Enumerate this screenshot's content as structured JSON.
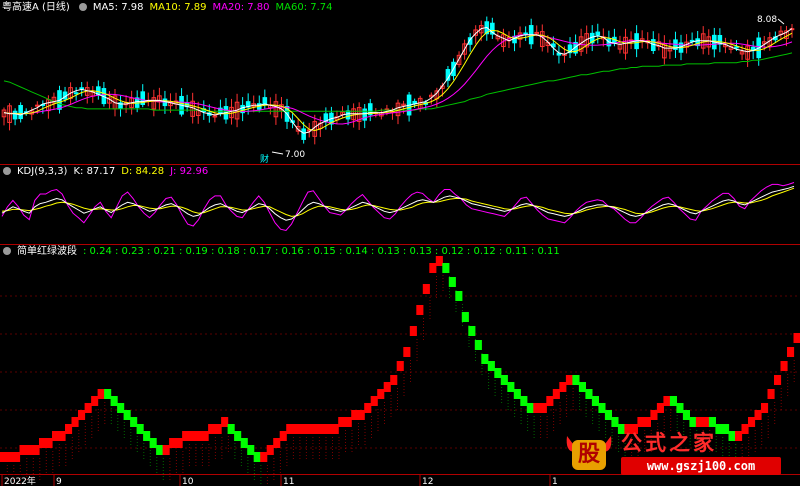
{
  "price_header": {
    "name": "粤高速A (日线)",
    "ma5": "MA5: 7.98",
    "ma10": "MA10: 7.89",
    "ma20": "MA20: 7.80",
    "ma60": "MA60: 7.74",
    "high_label": "8.08",
    "low_label": "7.00",
    "cai_mark": "财"
  },
  "kdj_header": {
    "name": "KDJ(9,3,3)",
    "k": "K: 87.17",
    "d": "D: 84.28",
    "j": "J: 92.96"
  },
  "wave_header": {
    "name": "简单红绿波段",
    "values": ": 0.24 : 0.23 : 0.21 : 0.19 : 0.18 : 0.17 : 0.16 : 0.15 : 0.14 : 0.13 : 0.13 : 0.12 : 0.12 : 0.11 : 0.11"
  },
  "x_axis": {
    "labels": [
      "2022年",
      "9",
      "10",
      "11",
      "12",
      "1"
    ]
  },
  "watermark": {
    "logo_text": "股",
    "title": "公式之家",
    "url": "www.gszj100.com"
  },
  "colors": {
    "up": "#ff3232",
    "down": "#00ffff",
    "ma5": "#ffffff",
    "ma10": "#ffff00",
    "ma20": "#ff00ff",
    "ma60": "#00c000",
    "k": "#ffffff",
    "d": "#ffff00",
    "j": "#ff00ff",
    "wave_up": "#ff0000",
    "wave_down": "#00ff00",
    "axis": "#b00000"
  },
  "chart_data": [
    {
      "type": "candlestick",
      "title": "粤高速A (日线)",
      "series": [
        {
          "name": "MA5",
          "values": [
            7.34,
            7.33,
            7.33,
            7.32,
            7.34,
            7.36,
            7.38,
            7.41,
            7.42,
            7.43,
            7.44,
            7.47,
            7.5,
            7.52,
            7.53,
            7.52,
            7.51,
            7.49,
            7.47,
            7.45,
            7.42,
            7.41,
            7.41,
            7.42,
            7.43,
            7.43,
            7.44,
            7.44,
            7.44,
            7.43,
            7.42,
            7.41,
            7.4,
            7.39,
            7.38,
            7.36,
            7.34,
            7.33,
            7.32,
            7.33,
            7.34,
            7.35,
            7.36,
            7.38,
            7.39,
            7.4,
            7.4,
            7.41,
            7.4,
            7.39,
            7.37,
            7.33,
            7.26,
            7.2,
            7.17,
            7.18,
            7.22,
            7.25,
            7.27,
            7.29,
            7.3,
            7.32,
            7.33,
            7.33,
            7.33,
            7.33,
            7.34,
            7.34,
            7.34,
            7.35,
            7.36,
            7.38,
            7.39,
            7.4,
            7.41,
            7.42,
            7.43,
            7.46,
            7.5,
            7.56,
            7.62,
            7.7,
            7.78,
            7.86,
            7.94,
            7.99,
            8.03,
            8.04,
            8.0,
            7.97,
            7.95,
            7.93,
            7.95,
            7.97,
            7.98,
            7.98,
            7.98,
            7.96,
            7.92,
            7.87,
            7.83,
            7.82,
            7.84,
            7.88,
            7.91,
            7.94,
            7.96,
            7.97,
            7.96,
            7.92,
            7.91,
            7.9,
            7.91,
            7.92,
            7.93,
            7.93,
            7.92,
            7.9,
            7.89,
            7.87,
            7.87,
            7.87,
            7.88,
            7.9,
            7.92,
            7.93,
            7.93,
            7.93,
            7.92,
            7.91,
            7.9,
            7.88,
            7.86,
            7.85,
            7.84,
            7.85,
            7.87,
            7.9,
            7.93,
            7.96,
            7.98,
            8.0,
            8.03
          ]
        },
        {
          "name": "MA60",
          "values": [
            7.6,
            7.59,
            7.57,
            7.55,
            7.53,
            7.51,
            7.49,
            7.47,
            7.45,
            7.43,
            7.41,
            7.4,
            7.39,
            7.38,
            7.38,
            7.37,
            7.37,
            7.37,
            7.37,
            7.37,
            7.37,
            7.37,
            7.37,
            7.37,
            7.37,
            7.37,
            7.37,
            7.36,
            7.36,
            7.36,
            7.36,
            7.36,
            7.36,
            7.36,
            7.36,
            7.36,
            7.36,
            7.35,
            7.35,
            7.35,
            7.35,
            7.35,
            7.35,
            7.35,
            7.35,
            7.35,
            7.35,
            7.35,
            7.35,
            7.35,
            7.35,
            7.35,
            7.35,
            7.35,
            7.35,
            7.35,
            7.35,
            7.35,
            7.35,
            7.35,
            7.35,
            7.35,
            7.35,
            7.35,
            7.35,
            7.35,
            7.35,
            7.35,
            7.36,
            7.36,
            7.36,
            7.36,
            7.36,
            7.36,
            7.36,
            7.37,
            7.37,
            7.37,
            7.38,
            7.39,
            7.4,
            7.41,
            7.42,
            7.43,
            7.45,
            7.46,
            7.47,
            7.49,
            7.5,
            7.51,
            7.52,
            7.53,
            7.54,
            7.55,
            7.56,
            7.57,
            7.58,
            7.59,
            7.6,
            7.6,
            7.61,
            7.62,
            7.63,
            7.64,
            7.65,
            7.65,
            7.66,
            7.67,
            7.68,
            7.68,
            7.69,
            7.7,
            7.7,
            7.71,
            7.71,
            7.72,
            7.72,
            7.72,
            7.72,
            7.73,
            7.73,
            7.73,
            7.73,
            7.74,
            7.74,
            7.74,
            7.74,
            7.74,
            7.75,
            7.75,
            7.75,
            7.75,
            7.75,
            7.76,
            7.76,
            7.77,
            7.77,
            7.78,
            7.79,
            7.8,
            7.81,
            7.82,
            7.83
          ]
        }
      ],
      "price_range": [
        6.95,
        8.15
      ]
    },
    {
      "type": "line",
      "title": "KDJ(9,3,3)",
      "series": [
        {
          "name": "K",
          "values": [
            45,
            50,
            55,
            52,
            48,
            45,
            55,
            60,
            62,
            65,
            68,
            66,
            60,
            55,
            50,
            45,
            48,
            52,
            55,
            50,
            46,
            52,
            58,
            62,
            60,
            56,
            52,
            48,
            50,
            54,
            58,
            60,
            56,
            50,
            44,
            40,
            42,
            48,
            54,
            58,
            60,
            56,
            52,
            48,
            46,
            50,
            55,
            60,
            58,
            52,
            44,
            38,
            34,
            36,
            42,
            50,
            58,
            62,
            60,
            56,
            52,
            50,
            48,
            50,
            54,
            58,
            62,
            60,
            56,
            52,
            48,
            46,
            48,
            52,
            56,
            60,
            64,
            66,
            64,
            62,
            66,
            70,
            72,
            70,
            68,
            64,
            60,
            58,
            56,
            54,
            52,
            50,
            48,
            50,
            54,
            58,
            60,
            58,
            54,
            50,
            46,
            44,
            42,
            40,
            42,
            46,
            50,
            54,
            56,
            58,
            58,
            56,
            54,
            50,
            46,
            42,
            40,
            42,
            46,
            50,
            54,
            58,
            60,
            58,
            54,
            50,
            46,
            44,
            48,
            52,
            56,
            60,
            64,
            66,
            64,
            60,
            58,
            62,
            66,
            70,
            74,
            78,
            80,
            82,
            84,
            87
          ]
        },
        {
          "name": "D",
          "values": [
            48,
            49,
            51,
            51,
            50,
            49,
            51,
            53,
            56,
            58,
            61,
            62,
            61,
            59,
            56,
            53,
            51,
            51,
            52,
            51,
            50,
            50,
            52,
            55,
            57,
            57,
            55,
            53,
            52,
            52,
            54,
            56,
            56,
            54,
            51,
            47,
            45,
            46,
            49,
            52,
            55,
            55,
            54,
            52,
            50,
            50,
            52,
            54,
            56,
            55,
            51,
            47,
            43,
            40,
            41,
            44,
            49,
            53,
            56,
            56,
            55,
            53,
            51,
            50,
            51,
            53,
            56,
            58,
            57,
            55,
            53,
            51,
            50,
            50,
            52,
            54,
            58,
            61,
            62,
            62,
            63,
            65,
            67,
            68,
            68,
            67,
            64,
            62,
            60,
            58,
            56,
            54,
            52,
            51,
            52,
            54,
            56,
            57,
            56,
            54,
            51,
            49,
            47,
            45,
            44,
            45,
            47,
            50,
            52,
            54,
            55,
            56,
            55,
            53,
            51,
            48,
            45,
            44,
            45,
            47,
            50,
            53,
            55,
            56,
            55,
            53,
            51,
            49,
            48,
            50,
            52,
            55,
            58,
            61,
            62,
            62,
            61,
            61,
            63,
            65,
            68,
            72,
            75,
            78,
            81,
            84
          ]
        },
        {
          "name": "J",
          "values": [
            40,
            55,
            65,
            55,
            42,
            35,
            65,
            75,
            75,
            80,
            82,
            75,
            58,
            45,
            38,
            30,
            42,
            55,
            62,
            48,
            38,
            55,
            72,
            78,
            68,
            55,
            45,
            38,
            46,
            58,
            68,
            70,
            58,
            42,
            28,
            25,
            35,
            52,
            66,
            72,
            72,
            58,
            48,
            40,
            38,
            50,
            62,
            72,
            62,
            46,
            30,
            20,
            18,
            28,
            45,
            62,
            78,
            80,
            68,
            56,
            46,
            44,
            42,
            50,
            60,
            68,
            74,
            64,
            54,
            46,
            38,
            36,
            44,
            56,
            66,
            74,
            78,
            76,
            68,
            62,
            74,
            82,
            82,
            74,
            68,
            58,
            52,
            50,
            48,
            46,
            44,
            42,
            40,
            48,
            58,
            68,
            70,
            60,
            50,
            42,
            36,
            34,
            32,
            30,
            38,
            48,
            56,
            62,
            64,
            66,
            64,
            56,
            52,
            44,
            36,
            30,
            30,
            38,
            48,
            56,
            62,
            68,
            70,
            62,
            52,
            44,
            36,
            34,
            48,
            56,
            64,
            70,
            76,
            76,
            68,
            56,
            52,
            64,
            72,
            80,
            86,
            90,
            90,
            88,
            90,
            93
          ]
        }
      ],
      "ylim": [
        0,
        100
      ]
    },
    {
      "type": "step",
      "title": "简单红绿波段",
      "series": [
        {
          "name": "简单红绿波段",
          "values": [
            0.11,
            0.11,
            0.11,
            0.12,
            0.12,
            0.12,
            0.13,
            0.13,
            0.14,
            0.14,
            0.15,
            0.16,
            0.17,
            0.18,
            0.19,
            0.2,
            0.2,
            0.19,
            0.18,
            0.17,
            0.16,
            0.15,
            0.14,
            0.13,
            0.12,
            0.12,
            0.13,
            0.13,
            0.14,
            0.14,
            0.14,
            0.14,
            0.15,
            0.15,
            0.16,
            0.15,
            0.14,
            0.13,
            0.12,
            0.11,
            0.11,
            0.12,
            0.13,
            0.14,
            0.15,
            0.15,
            0.15,
            0.15,
            0.15,
            0.15,
            0.15,
            0.15,
            0.16,
            0.16,
            0.17,
            0.17,
            0.18,
            0.19,
            0.2,
            0.21,
            0.22,
            0.24,
            0.26,
            0.29,
            0.32,
            0.35,
            0.38,
            0.39,
            0.38,
            0.36,
            0.34,
            0.31,
            0.29,
            0.27,
            0.25,
            0.24,
            0.23,
            0.22,
            0.21,
            0.2,
            0.19,
            0.18,
            0.18,
            0.18,
            0.19,
            0.2,
            0.21,
            0.22,
            0.22,
            0.21,
            0.2,
            0.19,
            0.18,
            0.17,
            0.16,
            0.15,
            0.15,
            0.15,
            0.16,
            0.16,
            0.17,
            0.18,
            0.19,
            0.19,
            0.18,
            0.17,
            0.16,
            0.16,
            0.16,
            0.16,
            0.15,
            0.15,
            0.14,
            0.14,
            0.15,
            0.16,
            0.17,
            0.18,
            0.2,
            0.22,
            0.24,
            0.26,
            0.28
          ]
        }
      ],
      "ylim": [
        0.1,
        0.4
      ]
    }
  ]
}
